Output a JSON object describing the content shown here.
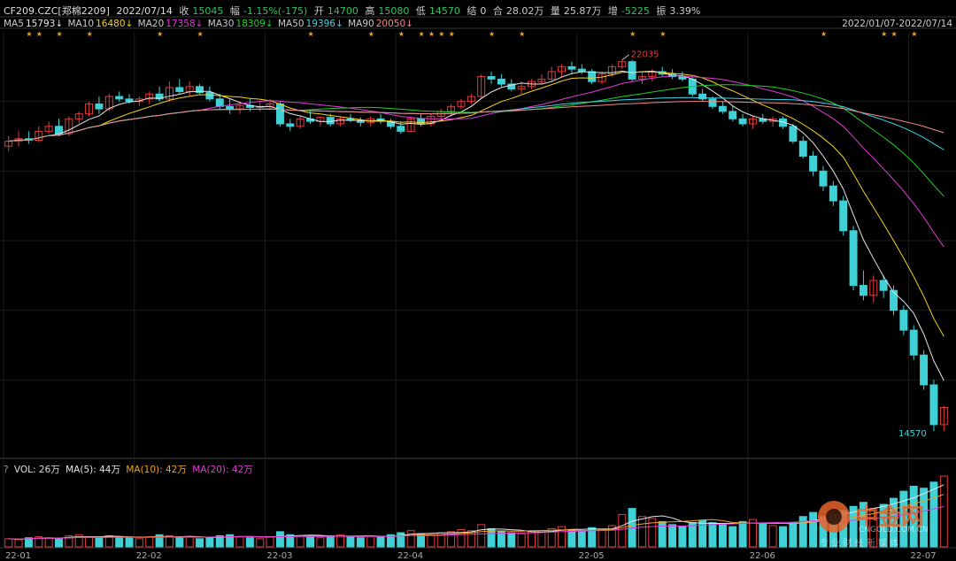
{
  "header": {
    "symbol": "CF209.CZC[郑棉2209]",
    "date": "2022/07/14",
    "close_label": "收",
    "close_value": "15045",
    "change_label": "幅",
    "change_value": "-1.15%(-175)",
    "open_label": "开",
    "open_value": "14700",
    "high_label": "高",
    "high_value": "15080",
    "low_label": "低",
    "low_value": "14570",
    "settle_label": "结",
    "settle_value": "0",
    "amount_label": "合",
    "amount_value": "28.02万",
    "volume_label": "量",
    "volume_value": "25.87万",
    "oi_label": "增",
    "oi_value": "-5225",
    "amp_label": "振",
    "amp_value": "3.39%"
  },
  "ma_legend": [
    {
      "label": "MA5",
      "value": "15793↓",
      "color": "#e6e6e6"
    },
    {
      "label": "MA10",
      "value": "16480↓",
      "color": "#f2d21d"
    },
    {
      "label": "MA20",
      "value": "17358↓",
      "color": "#e23ad9"
    },
    {
      "label": "MA30",
      "value": "18309↓",
      "color": "#1fcf2b"
    },
    {
      "label": "MA50",
      "value": "19396↓",
      "color": "#39d4e6"
    },
    {
      "label": "MA90",
      "value": "20050↓",
      "color": "#f08a8a"
    }
  ],
  "date_range": "2022/01/07-2022/07/14",
  "volume_legend": {
    "question": "?",
    "vol": "VOL: 26万",
    "ma5": "MA(5): 44万",
    "ma10": "MA(10): 42万",
    "ma20": "MA(20): 42万",
    "ma5_color": "#e6e6e6",
    "ma10_color": "#f2a21d",
    "ma20_color": "#e23ad9"
  },
  "watermark": {
    "main": "中金网",
    "sub": "CNGOLD.COM.CN",
    "tagline": "专 业 财 经 新 媒 体"
  },
  "chart_data": {
    "type": "candlestick",
    "x_ticks": [
      "22-01",
      "22-02",
      "22-03",
      "22-04",
      "22-05",
      "22-06",
      "22-07"
    ],
    "annotations": [
      {
        "label": "22035",
        "type": "high"
      },
      {
        "label": "14570",
        "type": "low"
      }
    ],
    "y_range": [
      14200,
      22600
    ],
    "candles": [
      {
        "o": 20300,
        "h": 20500,
        "l": 20200,
        "c": 20400
      },
      {
        "o": 20400,
        "h": 20600,
        "l": 20300,
        "c": 20450
      },
      {
        "o": 20450,
        "h": 20600,
        "l": 20350,
        "c": 20420
      },
      {
        "o": 20420,
        "h": 20700,
        "l": 20380,
        "c": 20600
      },
      {
        "o": 20600,
        "h": 20800,
        "l": 20550,
        "c": 20700
      },
      {
        "o": 20700,
        "h": 20850,
        "l": 20500,
        "c": 20550
      },
      {
        "o": 20550,
        "h": 20900,
        "l": 20500,
        "c": 20850
      },
      {
        "o": 20850,
        "h": 21000,
        "l": 20750,
        "c": 20950
      },
      {
        "o": 20950,
        "h": 21200,
        "l": 20900,
        "c": 21150
      },
      {
        "o": 21150,
        "h": 21300,
        "l": 20950,
        "c": 21050
      },
      {
        "o": 21050,
        "h": 21350,
        "l": 21000,
        "c": 21300
      },
      {
        "o": 21300,
        "h": 21400,
        "l": 21200,
        "c": 21250
      },
      {
        "o": 21250,
        "h": 21350,
        "l": 21150,
        "c": 21200
      },
      {
        "o": 21200,
        "h": 21300,
        "l": 21100,
        "c": 21250
      },
      {
        "o": 21250,
        "h": 21400,
        "l": 21150,
        "c": 21350
      },
      {
        "o": 21350,
        "h": 21500,
        "l": 21200,
        "c": 21250
      },
      {
        "o": 21250,
        "h": 21600,
        "l": 21200,
        "c": 21480
      },
      {
        "o": 21480,
        "h": 21650,
        "l": 21350,
        "c": 21400
      },
      {
        "o": 21400,
        "h": 21600,
        "l": 21300,
        "c": 21500
      },
      {
        "o": 21500,
        "h": 21550,
        "l": 21350,
        "c": 21380
      },
      {
        "o": 21380,
        "h": 21500,
        "l": 21200,
        "c": 21250
      },
      {
        "o": 21250,
        "h": 21350,
        "l": 21050,
        "c": 21100
      },
      {
        "o": 21100,
        "h": 21250,
        "l": 20950,
        "c": 21050
      },
      {
        "o": 21050,
        "h": 21200,
        "l": 20950,
        "c": 21120
      },
      {
        "o": 21120,
        "h": 21250,
        "l": 21000,
        "c": 21080
      },
      {
        "o": 21080,
        "h": 21200,
        "l": 21000,
        "c": 21100
      },
      {
        "o": 21100,
        "h": 21250,
        "l": 21050,
        "c": 21150
      },
      {
        "o": 21150,
        "h": 21200,
        "l": 20700,
        "c": 20750
      },
      {
        "o": 20750,
        "h": 20850,
        "l": 20600,
        "c": 20700
      },
      {
        "o": 20700,
        "h": 20900,
        "l": 20650,
        "c": 20850
      },
      {
        "o": 20850,
        "h": 21000,
        "l": 20750,
        "c": 20800
      },
      {
        "o": 20800,
        "h": 20900,
        "l": 20700,
        "c": 20880
      },
      {
        "o": 20880,
        "h": 20950,
        "l": 20700,
        "c": 20750
      },
      {
        "o": 20750,
        "h": 20900,
        "l": 20700,
        "c": 20850
      },
      {
        "o": 20850,
        "h": 20950,
        "l": 20780,
        "c": 20820
      },
      {
        "o": 20820,
        "h": 20880,
        "l": 20700,
        "c": 20780
      },
      {
        "o": 20780,
        "h": 20900,
        "l": 20700,
        "c": 20850
      },
      {
        "o": 20850,
        "h": 20950,
        "l": 20750,
        "c": 20800
      },
      {
        "o": 20800,
        "h": 20850,
        "l": 20650,
        "c": 20700
      },
      {
        "o": 20700,
        "h": 20800,
        "l": 20550,
        "c": 20600
      },
      {
        "o": 20600,
        "h": 20900,
        "l": 20580,
        "c": 20850
      },
      {
        "o": 20850,
        "h": 20950,
        "l": 20700,
        "c": 20750
      },
      {
        "o": 20750,
        "h": 20950,
        "l": 20700,
        "c": 20900
      },
      {
        "o": 20900,
        "h": 21050,
        "l": 20850,
        "c": 21000
      },
      {
        "o": 21000,
        "h": 21150,
        "l": 20900,
        "c": 21100
      },
      {
        "o": 21100,
        "h": 21250,
        "l": 21050,
        "c": 21200
      },
      {
        "o": 21200,
        "h": 21350,
        "l": 21150,
        "c": 21300
      },
      {
        "o": 21300,
        "h": 21750,
        "l": 21250,
        "c": 21700
      },
      {
        "o": 21700,
        "h": 21800,
        "l": 21550,
        "c": 21650
      },
      {
        "o": 21650,
        "h": 21750,
        "l": 21500,
        "c": 21550
      },
      {
        "o": 21550,
        "h": 21650,
        "l": 21400,
        "c": 21450
      },
      {
        "o": 21450,
        "h": 21600,
        "l": 21350,
        "c": 21500
      },
      {
        "o": 21500,
        "h": 21650,
        "l": 21450,
        "c": 21600
      },
      {
        "o": 21600,
        "h": 21750,
        "l": 21550,
        "c": 21650
      },
      {
        "o": 21650,
        "h": 21900,
        "l": 21600,
        "c": 21800
      },
      {
        "o": 21800,
        "h": 21950,
        "l": 21700,
        "c": 21900
      },
      {
        "o": 21900,
        "h": 22000,
        "l": 21750,
        "c": 21850
      },
      {
        "o": 21850,
        "h": 21950,
        "l": 21750,
        "c": 21800
      },
      {
        "o": 21800,
        "h": 21850,
        "l": 21550,
        "c": 21600
      },
      {
        "o": 21600,
        "h": 21800,
        "l": 21550,
        "c": 21750
      },
      {
        "o": 21750,
        "h": 21950,
        "l": 21700,
        "c": 21900
      },
      {
        "o": 21900,
        "h": 22035,
        "l": 21850,
        "c": 22000
      },
      {
        "o": 22000,
        "h": 22035,
        "l": 21600,
        "c": 21650
      },
      {
        "o": 21650,
        "h": 21800,
        "l": 21550,
        "c": 21700
      },
      {
        "o": 21700,
        "h": 21850,
        "l": 21600,
        "c": 21800
      },
      {
        "o": 21800,
        "h": 21900,
        "l": 21700,
        "c": 21750
      },
      {
        "o": 21750,
        "h": 21850,
        "l": 21650,
        "c": 21700
      },
      {
        "o": 21700,
        "h": 21800,
        "l": 21600,
        "c": 21650
      },
      {
        "o": 21650,
        "h": 21700,
        "l": 21300,
        "c": 21350
      },
      {
        "o": 21350,
        "h": 21450,
        "l": 21200,
        "c": 21250
      },
      {
        "o": 21250,
        "h": 21300,
        "l": 21050,
        "c": 21100
      },
      {
        "o": 21100,
        "h": 21200,
        "l": 20950,
        "c": 21000
      },
      {
        "o": 21000,
        "h": 21100,
        "l": 20800,
        "c": 20850
      },
      {
        "o": 20850,
        "h": 20950,
        "l": 20700,
        "c": 20750
      },
      {
        "o": 20750,
        "h": 20900,
        "l": 20650,
        "c": 20850
      },
      {
        "o": 20850,
        "h": 20950,
        "l": 20750,
        "c": 20800
      },
      {
        "o": 20800,
        "h": 20900,
        "l": 20700,
        "c": 20850
      },
      {
        "o": 20850,
        "h": 20900,
        "l": 20650,
        "c": 20700
      },
      {
        "o": 20700,
        "h": 20750,
        "l": 20350,
        "c": 20400
      },
      {
        "o": 20400,
        "h": 20500,
        "l": 20050,
        "c": 20100
      },
      {
        "o": 20100,
        "h": 20200,
        "l": 19700,
        "c": 19800
      },
      {
        "o": 19800,
        "h": 19900,
        "l": 19400,
        "c": 19500
      },
      {
        "o": 19500,
        "h": 19600,
        "l": 19100,
        "c": 19200
      },
      {
        "o": 19200,
        "h": 19300,
        "l": 18500,
        "c": 18600
      },
      {
        "o": 18600,
        "h": 18700,
        "l": 17400,
        "c": 17500
      },
      {
        "o": 17500,
        "h": 17800,
        "l": 17200,
        "c": 17300
      },
      {
        "o": 17300,
        "h": 17700,
        "l": 17150,
        "c": 17600
      },
      {
        "o": 17600,
        "h": 17700,
        "l": 17250,
        "c": 17400
      },
      {
        "o": 17400,
        "h": 17500,
        "l": 16900,
        "c": 17000
      },
      {
        "o": 17000,
        "h": 17100,
        "l": 16500,
        "c": 16600
      },
      {
        "o": 16600,
        "h": 16700,
        "l": 16000,
        "c": 16100
      },
      {
        "o": 16100,
        "h": 16200,
        "l": 15400,
        "c": 15500
      },
      {
        "o": 15500,
        "h": 15600,
        "l": 14570,
        "c": 14700
      },
      {
        "o": 14700,
        "h": 15080,
        "l": 14570,
        "c": 15045
      }
    ],
    "volumes": [
      8,
      7,
      9,
      10,
      9,
      8,
      11,
      12,
      10,
      9,
      11,
      10,
      9,
      8,
      10,
      12,
      11,
      9,
      10,
      8,
      9,
      11,
      12,
      10,
      9,
      8,
      10,
      15,
      12,
      11,
      10,
      9,
      11,
      12,
      10,
      9,
      11,
      10,
      12,
      14,
      16,
      13,
      12,
      14,
      15,
      17,
      16,
      22,
      18,
      15,
      14,
      13,
      15,
      16,
      18,
      20,
      17,
      15,
      19,
      17,
      21,
      32,
      38,
      30,
      28,
      25,
      22,
      20,
      24,
      26,
      24,
      22,
      20,
      25,
      27,
      23,
      21,
      20,
      24,
      30,
      34,
      30,
      32,
      36,
      40,
      44,
      38,
      42,
      48,
      55,
      60,
      58,
      64,
      70,
      55
    ]
  }
}
